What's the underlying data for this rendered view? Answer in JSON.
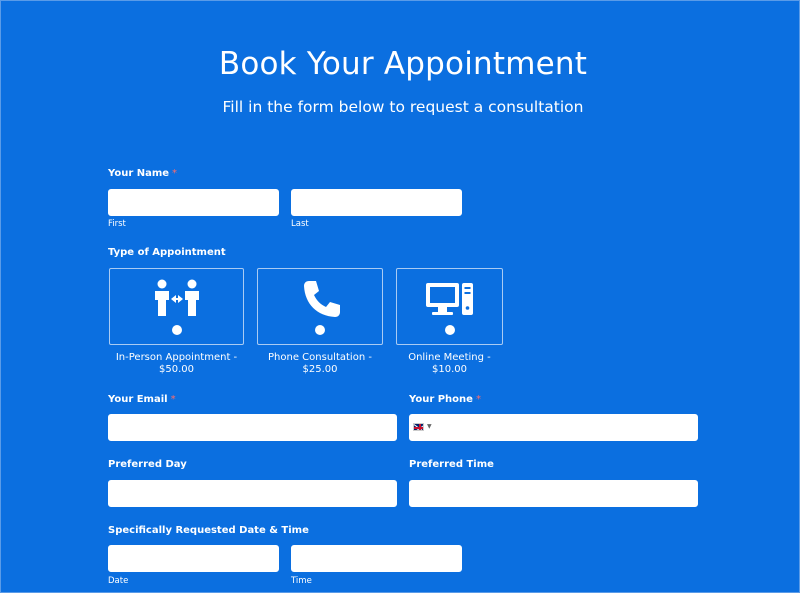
{
  "header": {
    "title": "Book Your Appointment",
    "subtitle": "Fill in the form below to request a consultation"
  },
  "form": {
    "name": {
      "label": "Your Name",
      "required_mark": "*",
      "first_sublabel": "First",
      "last_sublabel": "Last",
      "first_value": "",
      "last_value": ""
    },
    "appointment_type": {
      "label": "Type of Appointment",
      "options": [
        {
          "label": "In-Person Appointment - $50.00",
          "icon": "in-person-icon"
        },
        {
          "label": "Phone Consultation - $25.00",
          "icon": "phone-icon"
        },
        {
          "label": "Online Meeting - $10.00",
          "icon": "computer-icon"
        }
      ]
    },
    "email": {
      "label": "Your Email",
      "required_mark": "*",
      "value": ""
    },
    "phone": {
      "label": "Your Phone",
      "required_mark": "*",
      "value": "",
      "country_icon": "uk-flag-icon"
    },
    "preferred_day": {
      "label": "Preferred Day",
      "value": ""
    },
    "preferred_time": {
      "label": "Preferred Time",
      "value": ""
    },
    "requested_datetime": {
      "label": "Specifically Requested Date & Time",
      "date_sublabel": "Date",
      "time_sublabel": "Time",
      "date_value": "",
      "time_value": ""
    }
  },
  "colors": {
    "background": "#0B6FE0",
    "text": "#ffffff",
    "required": "#ff6b6b"
  }
}
